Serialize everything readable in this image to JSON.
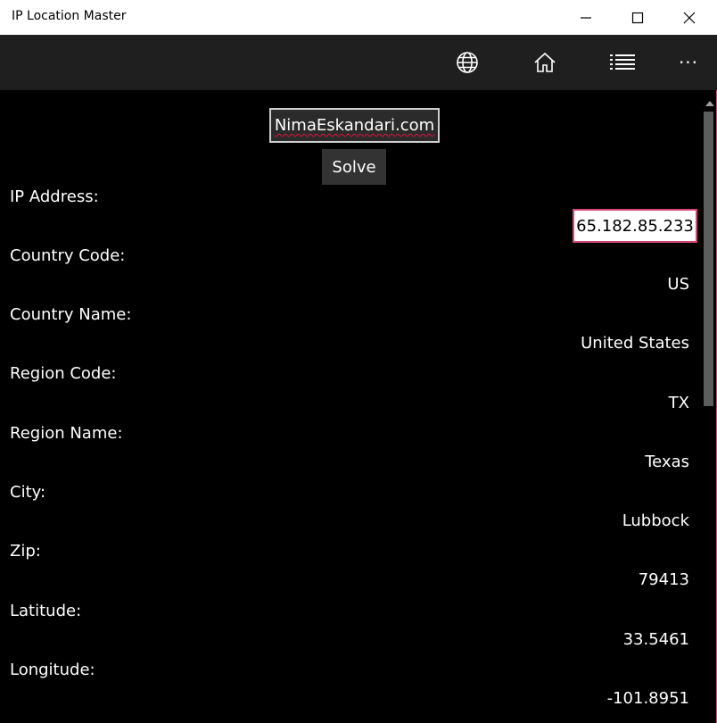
{
  "window": {
    "title": "IP Location Master",
    "minimize_icon": "minimize-icon",
    "maximize_icon": "maximize-icon",
    "close_icon": "close-icon"
  },
  "commandbar": {
    "icons": [
      "globe-icon",
      "home-icon",
      "list-icon",
      "more-icon"
    ],
    "more_glyph": "···"
  },
  "form": {
    "domain_value": "NimaEskandari.com",
    "solve_label": "Solve"
  },
  "fields": [
    {
      "label": "IP Address:",
      "value": "65.182.85.233"
    },
    {
      "label": "Country Code:",
      "value": "US"
    },
    {
      "label": "Country Name:",
      "value": "United States"
    },
    {
      "label": "Region Code:",
      "value": "TX"
    },
    {
      "label": "Region Name:",
      "value": "Texas"
    },
    {
      "label": "City:",
      "value": "Lubbock"
    },
    {
      "label": "Zip:",
      "value": "79413"
    },
    {
      "label": "Latitude:",
      "value": "33.5461"
    },
    {
      "label": "Longitude:",
      "value": "-101.8951"
    }
  ],
  "colors": {
    "accent": "#d6477a",
    "spellcheck": "#e0143c",
    "commandbar_bg": "#1f1f1f"
  }
}
